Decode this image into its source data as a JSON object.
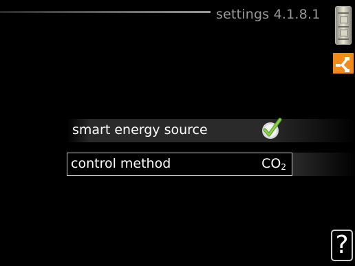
{
  "header": {
    "title": "settings 4.1.8.1",
    "scroll_icon": "scroll-position-icon",
    "menu_icon": "energy-source-icon"
  },
  "menu": {
    "items": [
      {
        "label": "smart energy source",
        "state": "checked",
        "icon": "checkmark-icon"
      },
      {
        "label": "control method",
        "value_main": "CO",
        "value_sub": "2",
        "selected": true
      }
    ]
  },
  "help": {
    "label": "?"
  },
  "colors": {
    "background": "#000000",
    "text": "#ffffff",
    "title": "#9a9a9a",
    "check": "#7cc142",
    "menu_icon": "#f08a1a"
  }
}
